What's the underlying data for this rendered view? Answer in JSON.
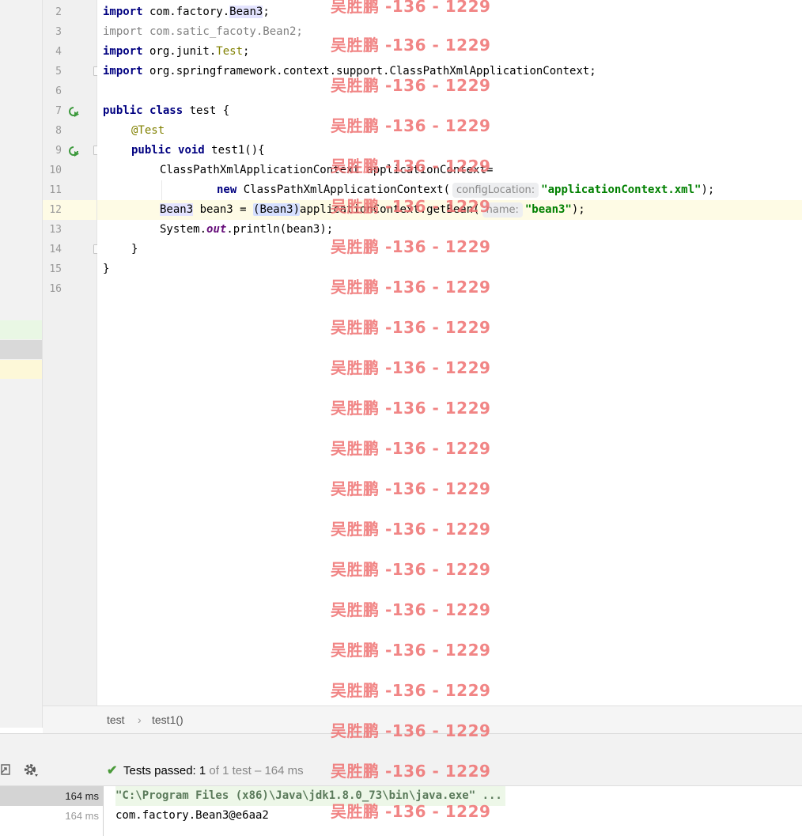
{
  "editor": {
    "line_numbers": [
      "2",
      "3",
      "4",
      "5",
      "6",
      "7",
      "8",
      "9",
      "10",
      "11",
      "12",
      "13",
      "14",
      "15",
      "16"
    ],
    "lines": {
      "l2": {
        "kw": "import",
        "rest": " com.factory.",
        "cls": "Bean3",
        "end": ";"
      },
      "l3": {
        "text": "import com.satic_facoty.Bean2;"
      },
      "l4": {
        "kw": "import",
        "rest": " org.junit.",
        "cls": "Test",
        "end": ";"
      },
      "l5": {
        "kw": "import",
        "rest": " org.springframework.context.support.ClassPathXmlApplicationContext;"
      },
      "l7": {
        "kw1": "public",
        "kw2": "class",
        "rest": " test {"
      },
      "l8": {
        "text": "@Test"
      },
      "l9": {
        "kw1": "public",
        "kw2": "void",
        "rest": " test1(){"
      },
      "l10": {
        "text": "ClassPathXmlApplicationContext applicationContext="
      },
      "l11": {
        "kw": "new",
        "rest": " ClassPathXmlApplicationContext(",
        "hint": "configLocation:",
        "str": "\"applicationContext.xml\"",
        "end": ");"
      },
      "l12": {
        "cls": "Bean3",
        "mid": " bean3 = ",
        "cast": "(Bean3)",
        "rest": "applicationContext.getBean(",
        "hint": "name:",
        "str": "\"bean3\"",
        "end": ");"
      },
      "l13": {
        "pre": "System.",
        "field": "out",
        "rest": ".println(bean3);"
      },
      "l14": {
        "text": "}"
      },
      "l15": {
        "text": "}"
      }
    }
  },
  "breadcrumb": {
    "class_name": "test",
    "separator": "›",
    "method_name": "test1()"
  },
  "run": {
    "status_prefix": "Tests passed:",
    "status_count": "1",
    "status_suffix": "of 1 test – 164 ms",
    "tree": [
      {
        "time": "164 ms"
      },
      {
        "time": "164 ms"
      }
    ],
    "console": [
      "\"C:\\Program Files (x86)\\Java\\jdk1.8.0_73\\bin\\java.exe\" ...",
      "com.factory.Bean3@e6aa2"
    ]
  },
  "watermark": {
    "text": "吴胜鹏 -136 - 1229"
  },
  "icons": {
    "run_gutter": "run-test-icon",
    "settings": "gear-icon",
    "restore": "restore-layout-icon",
    "passed": "check-icon"
  },
  "colors": {
    "keyword": "#000080",
    "string": "#008000",
    "annotation": "#808000",
    "watermark": "#ef7070",
    "current_line": "#fefbe5"
  }
}
